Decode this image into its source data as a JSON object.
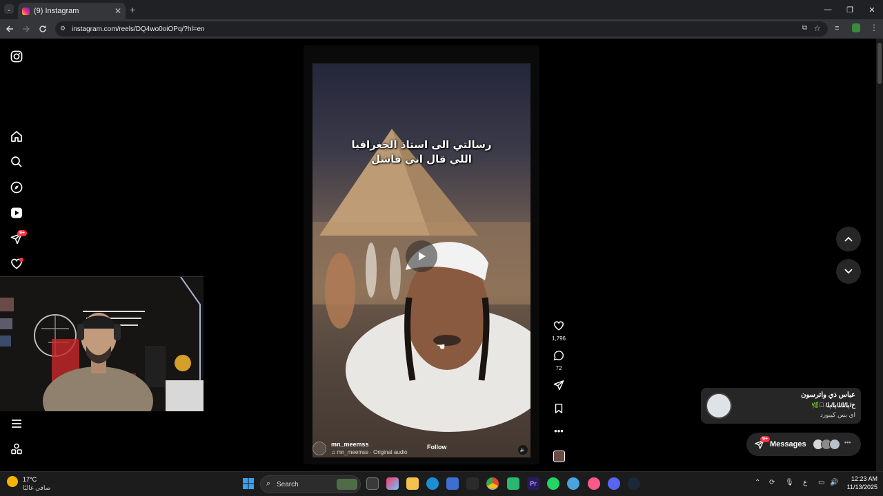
{
  "browser": {
    "tab": {
      "title": "(9) Instagram"
    },
    "url": "instagram.com/reels/DQ4wo0oiOPq/?hl=en",
    "window_controls": [
      "—",
      "❐",
      "✕"
    ]
  },
  "sidebar": {
    "items": [
      {
        "name": "instagram-logo"
      },
      {
        "name": "home"
      },
      {
        "name": "search"
      },
      {
        "name": "explore"
      },
      {
        "name": "reels"
      },
      {
        "name": "messages",
        "badge": "9+"
      },
      {
        "name": "notifications"
      }
    ]
  },
  "reel": {
    "caption_line1": "رسالتي الى استاذ الجغرافيا",
    "caption_line2": "اللي قال اني فاشل",
    "author": "mn_meemss",
    "audio": "mn_meemss · Original audio",
    "follow_label": "Follow",
    "likes": "1,796",
    "comments": "72"
  },
  "notification": {
    "name": "عباس ذي واترسون",
    "subtitle": "خ/ﺑﻠ/ﻠ/ﻠ/ﺑﻠ/ﺑﻠ/ 🏼🌿",
    "message": "اي بس كيبورد"
  },
  "messages_pill": {
    "label": "Messages",
    "badge": "9+"
  },
  "taskbar": {
    "weather_temp": "17°C",
    "weather_desc": "صافي غالبًا",
    "search_placeholder": "Search",
    "time": "12:23 AM",
    "date": "11/13/2025",
    "lang": "ع"
  },
  "colors": {
    "accent_red": "#ff3040",
    "page_bg": "#000000",
    "chrome_bg": "#202124"
  }
}
